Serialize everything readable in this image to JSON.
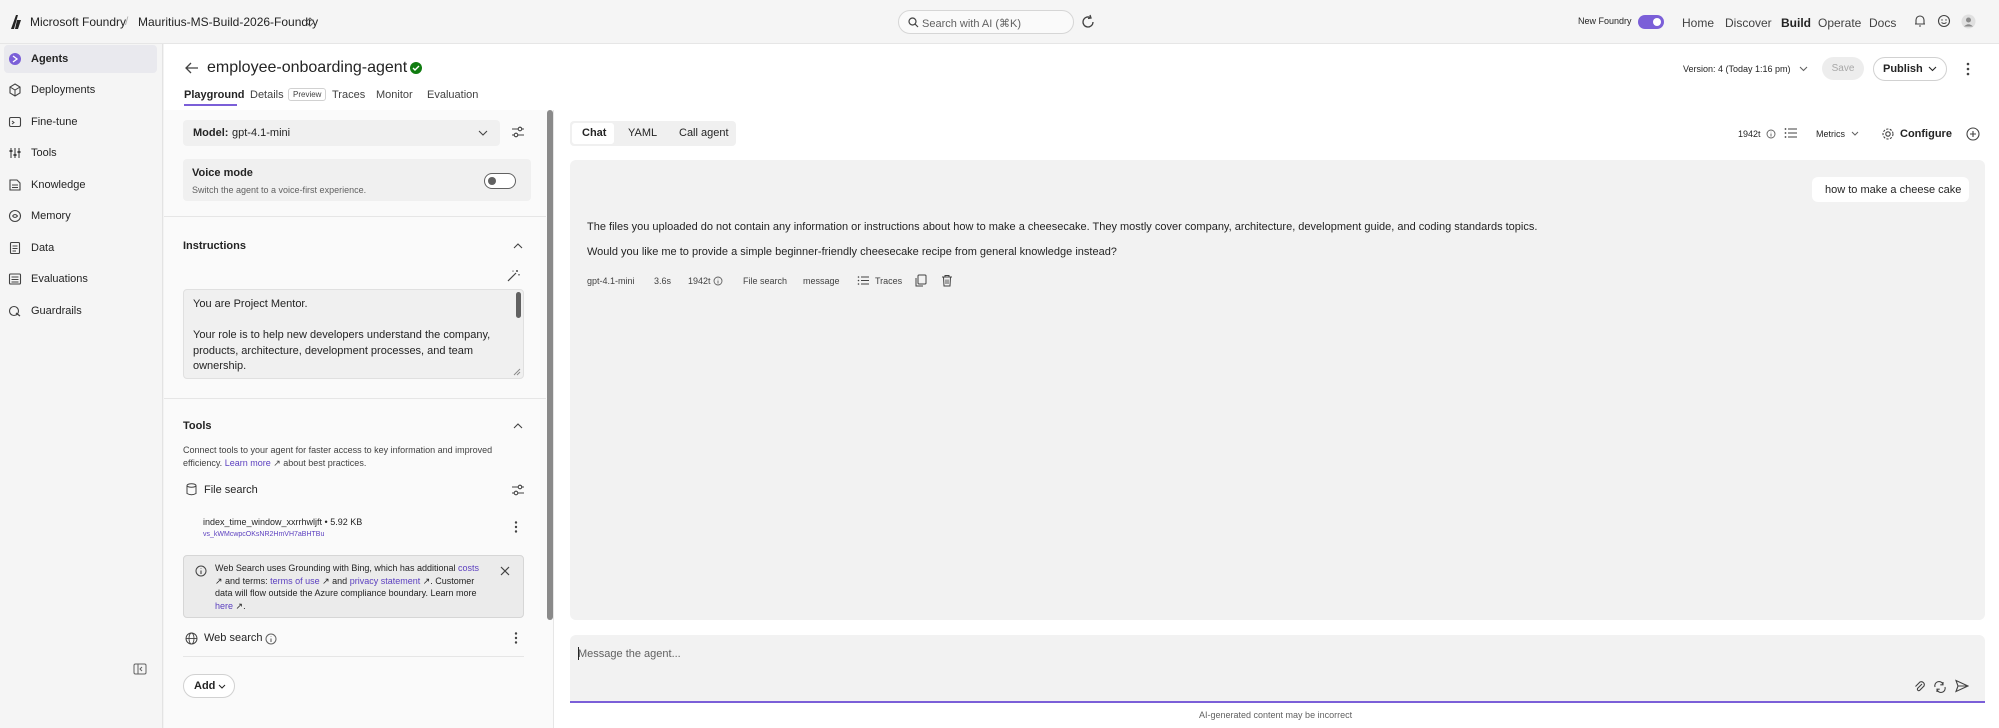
{
  "topbar": {
    "brand": "Microsoft Foundry",
    "separator": "/",
    "project": "Mauritius-MS-Build-2026-Foundry",
    "search_placeholder": "Search with AI (⌘K)",
    "new_foundry_label": "New Foundry",
    "new_foundry_on": true,
    "nav": [
      "Home",
      "Discover",
      "Build",
      "Operate",
      "Docs"
    ],
    "active_nav": "Build"
  },
  "sidebar": {
    "items": [
      {
        "label": "Agents",
        "icon": "agents-icon",
        "active": true
      },
      {
        "label": "Deployments",
        "icon": "deployments-icon",
        "active": false
      },
      {
        "label": "Fine-tune",
        "icon": "fine-tune-icon",
        "active": false
      },
      {
        "label": "Tools",
        "icon": "tools-icon",
        "active": false
      },
      {
        "label": "Knowledge",
        "icon": "knowledge-icon",
        "active": false
      },
      {
        "label": "Memory",
        "icon": "memory-icon",
        "active": false
      },
      {
        "label": "Data",
        "icon": "data-icon",
        "active": false
      },
      {
        "label": "Evaluations",
        "icon": "evaluations-icon",
        "active": false
      },
      {
        "label": "Guardrails",
        "icon": "guardrails-icon",
        "active": false
      }
    ]
  },
  "agent": {
    "name": "employee-onboarding-agent",
    "tabs": [
      "Playground",
      "Details",
      "Traces",
      "Monitor",
      "Evaluation"
    ],
    "active_tab": "Playground",
    "details_badge": "Preview",
    "version": "Version: 4 (Today 1:16 pm)",
    "save_label": "Save",
    "publish_label": "Publish"
  },
  "config": {
    "model_label": "Model:",
    "model_value": "gpt-4.1-mini",
    "voice_title": "Voice mode",
    "voice_desc": "Switch the agent to a voice-first experience.",
    "voice_on": false,
    "instructions_title": "Instructions",
    "instructions_line1": "You are Project Mentor.",
    "instructions_line2": "Your role is to help new developers understand the company, products, architecture, development processes, and team ownership.",
    "tools_title": "Tools",
    "tools_desc_1": "Connect tools to your agent for faster access to key information and improved efficiency. ",
    "tools_learn_more": "Learn more",
    "tools_desc_2": " about best practices.",
    "file_search_label": "File search",
    "index_name": "index_time_window_xxrrhwljft • 5.92 KB",
    "index_id": "vs_kWMcwpcOKsNR2HmVH7aBHTBu",
    "bing_text_1": "Web Search uses Grounding with Bing, which has additional ",
    "bing_costs": "costs",
    "bing_text_2": " and terms: ",
    "bing_terms": "terms of use",
    "bing_text_3": " and ",
    "bing_privacy": "privacy statement",
    "bing_text_4": ". Customer data will flow outside the Azure compliance boundary. Learn more ",
    "bing_here": "here",
    "bing_text_5": ".",
    "web_search_label": "Web search",
    "add_label": "Add"
  },
  "chat": {
    "tabs": [
      "Chat",
      "YAML",
      "Call agent"
    ],
    "active_tab": "Chat",
    "tokens": "1942t",
    "metrics_label": "Metrics",
    "configure_label": "Configure",
    "user_message": "how to make a cheese cake",
    "reply_line1": "The files you uploaded do not contain any information or instructions about how to make a cheesecake. They mostly cover company, architecture, development guide, and coding standards topics.",
    "reply_line2": "Would you like me to provide a simple beginner-friendly cheesecake recipe from general knowledge instead?",
    "meta_model": "gpt-4.1-mini",
    "meta_time": "3.6s",
    "meta_tokens": "1942t",
    "meta_tool": "File search",
    "meta_type": "message",
    "meta_traces": "Traces",
    "composer_placeholder": "Message the agent...",
    "disclaimer": "AI-generated content may be incorrect"
  },
  "colors": {
    "accent": "#7b5fd8",
    "verified": "#107c10"
  }
}
